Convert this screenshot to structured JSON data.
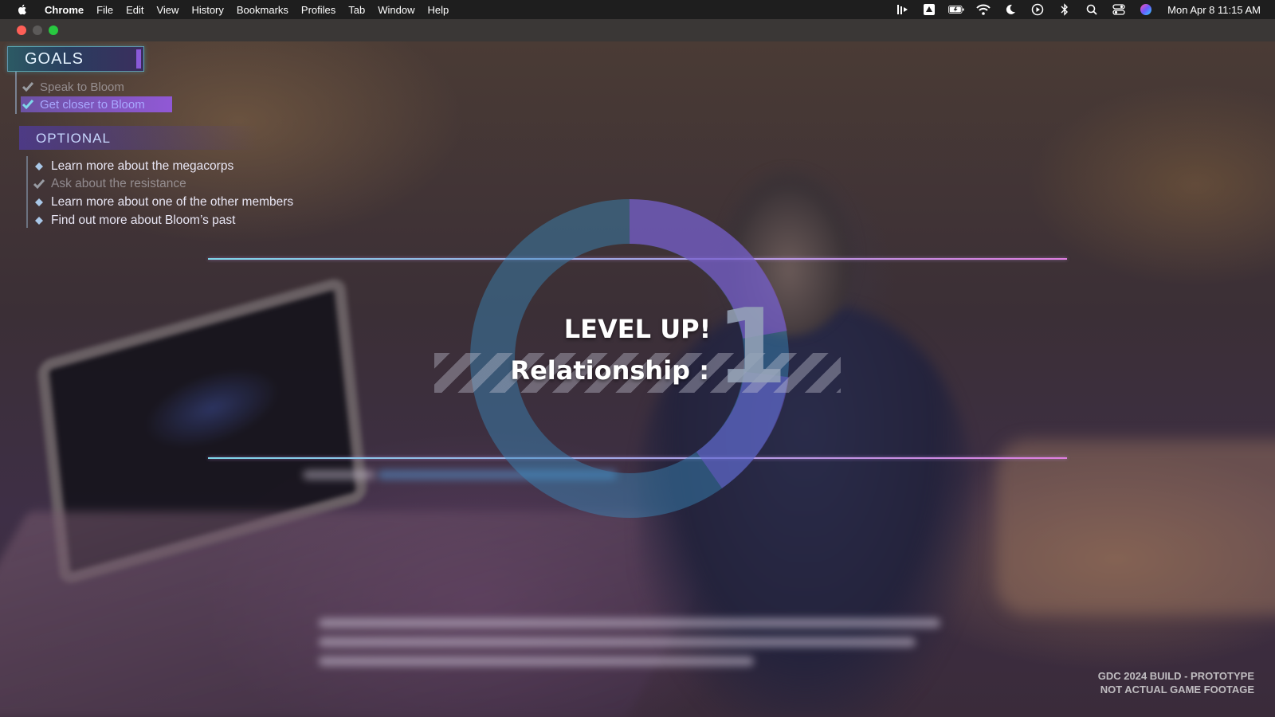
{
  "menubar": {
    "app_name": "Chrome",
    "items": [
      "File",
      "Edit",
      "View",
      "History",
      "Bookmarks",
      "Profiles",
      "Tab",
      "Window",
      "Help"
    ],
    "clock": "Mon Apr 8  11:15 AM"
  },
  "hud": {
    "goals_title": "GOALS",
    "goals": [
      {
        "label": "Speak to Bloom",
        "state": "done"
      },
      {
        "label": "Get closer to Bloom",
        "state": "active"
      }
    ],
    "optional_title": "OPTIONAL",
    "optional": [
      {
        "label": "Learn more about the megacorps",
        "state": "open"
      },
      {
        "label": "Ask about the resistance",
        "state": "done"
      },
      {
        "label": "Learn more about one of the other members",
        "state": "open"
      },
      {
        "label": "Find out more about Bloom’s past",
        "state": "open"
      }
    ]
  },
  "level_up": {
    "title": "LEVEL UP!",
    "subtitle": "Relationship :",
    "level": "1"
  },
  "watermark": {
    "line1": "GDC 2024 BUILD - PROTOTYPE",
    "line2": "NOT ACTUAL GAME FOOTAGE"
  },
  "colors": {
    "accent_cyan": "#7fd7ea",
    "accent_magenta": "#e07ee0",
    "accent_purple": "#8a5ad8"
  }
}
